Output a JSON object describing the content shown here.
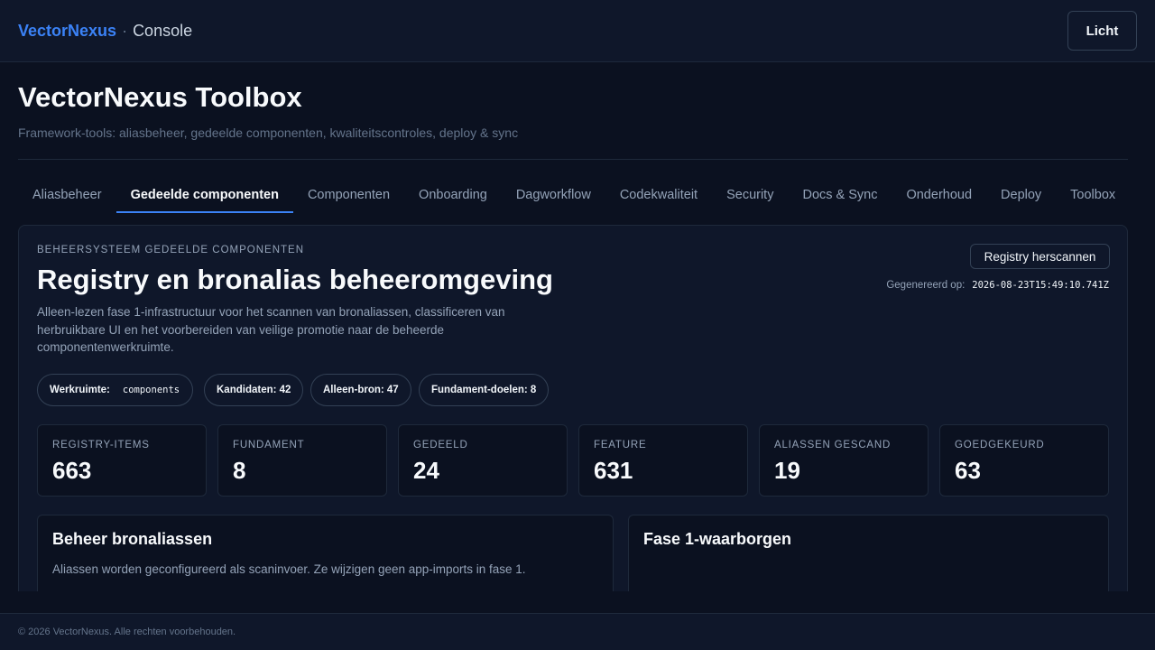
{
  "header": {
    "brand": "VectorNexus",
    "separator": "·",
    "section": "Console",
    "theme_toggle_label": "Licht"
  },
  "page": {
    "title": "VectorNexus Toolbox",
    "subtitle": "Framework-tools: aliasbeheer, gedeelde componenten, kwaliteitscontroles, deploy & sync"
  },
  "tabs": [
    {
      "label": "Aliasbeheer",
      "active": false
    },
    {
      "label": "Gedeelde componenten",
      "active": true
    },
    {
      "label": "Componenten",
      "active": false
    },
    {
      "label": "Onboarding",
      "active": false
    },
    {
      "label": "Dagworkflow",
      "active": false
    },
    {
      "label": "Codekwaliteit",
      "active": false
    },
    {
      "label": "Security",
      "active": false
    },
    {
      "label": "Docs & Sync",
      "active": false
    },
    {
      "label": "Onderhoud",
      "active": false
    },
    {
      "label": "Deploy",
      "active": false
    },
    {
      "label": "Toolbox",
      "active": false
    }
  ],
  "panel": {
    "eyebrow": "Beheersysteem gedeelde componenten",
    "title": "Registry en bronalias beheeromgeving",
    "description": "Alleen-lezen fase 1-infrastructuur voor het scannen van bronaliassen, classificeren van herbruikbare UI en het voorbereiden van veilige promotie naar de beheerde componentenwerkruimte.",
    "rescan_label": "Registry herscannen",
    "generated_label": "Gegenereerd op:",
    "generated_value": "2026-08-23T15:49:10.741Z",
    "chips": {
      "workspace_label": "Werkruimte:",
      "workspace_value": "components",
      "candidates": "Kandidaten: 42",
      "source_only": "Alleen-bron: 47",
      "foundation_targets": "Fundament-doelen: 8"
    },
    "stats": [
      {
        "label": "Registry-items",
        "value": "663"
      },
      {
        "label": "Fundament",
        "value": "8"
      },
      {
        "label": "Gedeeld",
        "value": "24"
      },
      {
        "label": "Feature",
        "value": "631"
      },
      {
        "label": "Aliassen gescand",
        "value": "19"
      },
      {
        "label": "Goedgekeurd",
        "value": "63"
      }
    ],
    "cards": {
      "aliases_title": "Beheer bronaliassen",
      "aliases_desc": "Aliassen worden geconfigureerd als scaninvoer. Ze wijzigen geen app-imports in fase 1.",
      "guarantees_title": "Fase 1-waarborgen"
    }
  },
  "footer": {
    "text": "© 2026 VectorNexus. Alle rechten voorbehouden."
  }
}
